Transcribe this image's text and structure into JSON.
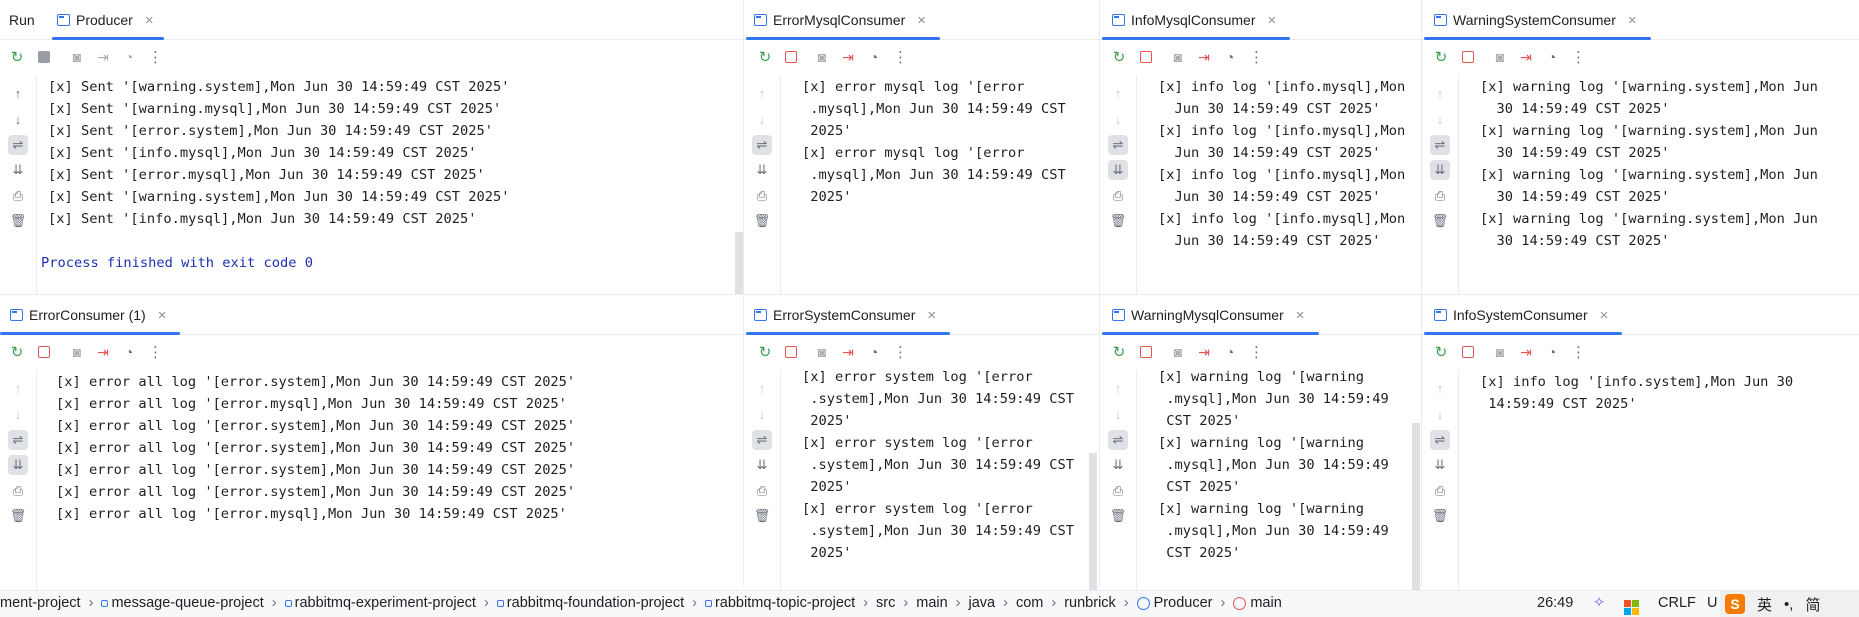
{
  "run_label": "Run",
  "panels": {
    "producer": {
      "tab": "Producer",
      "lines": [
        "[x] Sent '[warning.system],Mon Jun 30 14:59:49 CST 2025'",
        "[x] Sent '[warning.mysql],Mon Jun 30 14:59:49 CST 2025'",
        "[x] Sent '[error.system],Mon Jun 30 14:59:49 CST 2025'",
        "[x] Sent '[info.mysql],Mon Jun 30 14:59:49 CST 2025'",
        "[x] Sent '[error.mysql],Mon Jun 30 14:59:49 CST 2025'",
        "[x] Sent '[warning.system],Mon Jun 30 14:59:49 CST 2025'",
        "[x] Sent '[info.mysql],Mon Jun 30 14:59:49 CST 2025'"
      ],
      "finish": "Process finished with exit code 0"
    },
    "error_mysql": {
      "tab": "ErrorMysqlConsumer",
      "lines": [
        "[x] error mysql log '[error",
        " .mysql],Mon Jun 30 14:59:49 CST",
        " 2025'",
        "[x] error mysql log '[error",
        " .mysql],Mon Jun 30 14:59:49 CST",
        " 2025'"
      ]
    },
    "info_mysql": {
      "tab": "InfoMysqlConsumer",
      "lines": [
        "[x] info log '[info.mysql],Mon",
        "  Jun 30 14:59:49 CST 2025'",
        "[x] info log '[info.mysql],Mon",
        "  Jun 30 14:59:49 CST 2025'",
        "[x] info log '[info.mysql],Mon",
        "  Jun 30 14:59:49 CST 2025'",
        "[x] info log '[info.mysql],Mon",
        "  Jun 30 14:59:49 CST 2025'"
      ]
    },
    "warning_system": {
      "tab": "WarningSystemConsumer",
      "lines": [
        "[x] warning log '[warning.system],Mon Jun",
        "  30 14:59:49 CST 2025'",
        "[x] warning log '[warning.system],Mon Jun",
        "  30 14:59:49 CST 2025'",
        "[x] warning log '[warning.system],Mon Jun",
        "  30 14:59:49 CST 2025'",
        "[x] warning log '[warning.system],Mon Jun",
        "  30 14:59:49 CST 2025'"
      ]
    },
    "error_consumer": {
      "tab": "ErrorConsumer (1)",
      "lines": [
        "[x] error all log '[error.system],Mon Jun 30 14:59:49 CST 2025'",
        "[x] error all log '[error.mysql],Mon Jun 30 14:59:49 CST 2025'",
        "[x] error all log '[error.system],Mon Jun 30 14:59:49 CST 2025'",
        "[x] error all log '[error.system],Mon Jun 30 14:59:49 CST 2025'",
        "[x] error all log '[error.system],Mon Jun 30 14:59:49 CST 2025'",
        "[x] error all log '[error.system],Mon Jun 30 14:59:49 CST 2025'",
        "[x] error all log '[error.mysql],Mon Jun 30 14:59:49 CST 2025'"
      ]
    },
    "error_system": {
      "tab": "ErrorSystemConsumer",
      "lines": [
        "[x] error system log '[error",
        " .system],Mon Jun 30 14:59:49 CST",
        " 2025'",
        "[x] error system log '[error",
        " .system],Mon Jun 30 14:59:49 CST",
        " 2025'",
        "[x] error system log '[error",
        " .system],Mon Jun 30 14:59:49 CST",
        " 2025'"
      ]
    },
    "warning_mysql": {
      "tab": "WarningMysqlConsumer",
      "lines": [
        "[x] warning log '[warning",
        " .mysql],Mon Jun 30 14:59:49",
        " CST 2025'",
        "[x] warning log '[warning",
        " .mysql],Mon Jun 30 14:59:49",
        " CST 2025'",
        "[x] warning log '[warning",
        " .mysql],Mon Jun 30 14:59:49",
        " CST 2025'"
      ]
    },
    "info_system": {
      "tab": "InfoSystemConsumer",
      "lines": [
        "[x] info log '[info.system],Mon Jun 30",
        " 14:59:49 CST 2025'"
      ]
    }
  },
  "statusbar": {
    "crumbs": [
      "ment-project",
      "message-queue-project",
      "rabbitmq-experiment-project",
      "rabbitmq-foundation-project",
      "rabbitmq-topic-project",
      "src",
      "main",
      "java",
      "com",
      "runbrick",
      "Producer",
      "main"
    ],
    "position": "26:49",
    "line_ending": "CRLF",
    "encoding_partial": "U",
    "ime_lang": "英",
    "ime_extra": "简"
  },
  "colors": {
    "accent": "#3574f0",
    "stop": "#e55353",
    "rerun": "#3f9f4f",
    "finish_text": "#1d31b0"
  }
}
